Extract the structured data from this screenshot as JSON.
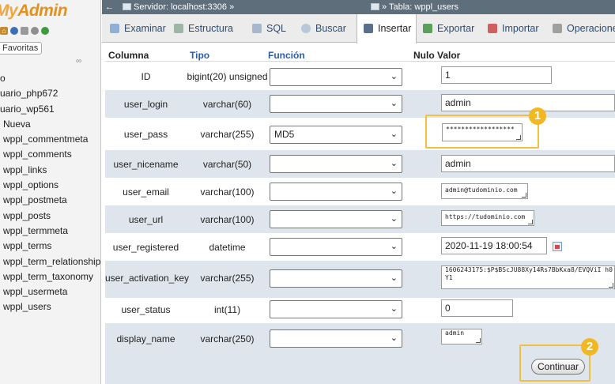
{
  "sidebar": {
    "logo_my": "My",
    "logo_admin": "Admin",
    "favorites_label": "Favoritas",
    "tree": [
      "o",
      "uario_php672",
      "uario_wp561",
      "Nueva",
      "wppl_commentmeta",
      "wppl_comments",
      "wppl_links",
      "wppl_options",
      "wppl_postmeta",
      "wppl_posts",
      "wppl_termmeta",
      "wppl_terms",
      "wppl_term_relationships",
      "wppl_term_taxonomy",
      "wppl_usermeta",
      "wppl_users"
    ]
  },
  "topbar": {
    "server": "Servidor: localhost:3306 »",
    "table": "» Tabla: wppl_users"
  },
  "tabs": [
    {
      "label": "Examinar",
      "icon": "browse-icon"
    },
    {
      "label": "Estructura",
      "icon": "structure-icon"
    },
    {
      "label": "SQL",
      "icon": "sql-icon"
    },
    {
      "label": "Buscar",
      "icon": "search-icon"
    },
    {
      "label": "Insertar",
      "icon": "insert-icon",
      "active": true
    },
    {
      "label": "Exportar",
      "icon": "export-icon"
    },
    {
      "label": "Importar",
      "icon": "import-icon"
    },
    {
      "label": "Operaciones",
      "icon": "wrench-icon"
    }
  ],
  "headers": {
    "column": "Columna",
    "type": "Tipo",
    "function": "Función",
    "null": "Nulo",
    "value": "Valor"
  },
  "rows": [
    {
      "name": "ID",
      "type": "bigint(20) unsigned",
      "function": "",
      "value": "1"
    },
    {
      "name": "user_login",
      "type": "varchar(60)",
      "function": "",
      "value": "admin"
    },
    {
      "name": "user_pass",
      "type": "varchar(255)",
      "function": "MD5",
      "value": "******************"
    },
    {
      "name": "user_nicename",
      "type": "varchar(50)",
      "function": "",
      "value": "admin"
    },
    {
      "name": "user_email",
      "type": "varchar(100)",
      "function": "",
      "value": "admin@tudominio.com"
    },
    {
      "name": "user_url",
      "type": "varchar(100)",
      "function": "",
      "value": "https://tudominio.com"
    },
    {
      "name": "user_registered",
      "type": "datetime",
      "function": "",
      "value": "2020-11-19 18:00:54"
    },
    {
      "name": "user_activation_key",
      "type": "varchar(255)",
      "function": "",
      "value": "1606243175:$P$BScJU88Xy14Rs7BbKxa8/EVQViI h0Y1"
    },
    {
      "name": "user_status",
      "type": "int(11)",
      "function": "",
      "value": "0"
    },
    {
      "name": "display_name",
      "type": "varchar(250)",
      "function": "",
      "value": "admin"
    }
  ],
  "annotations": {
    "badge1": "1",
    "badge2": "2",
    "color": "#f2b824"
  },
  "continue_label": "Continuar"
}
